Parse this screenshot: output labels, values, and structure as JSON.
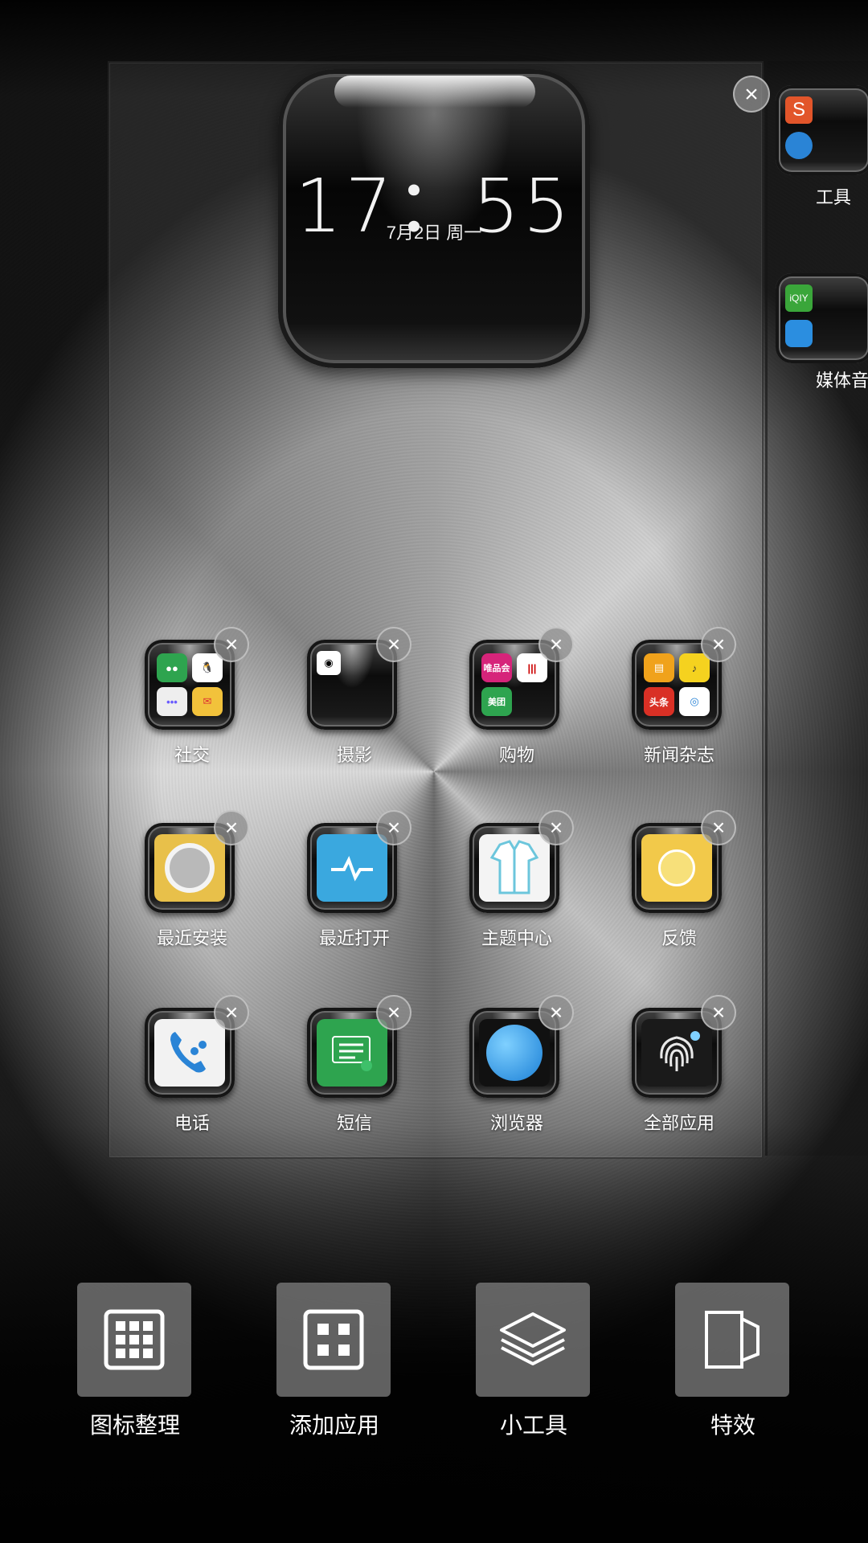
{
  "clock": {
    "time": "17：55",
    "date": "7月2日 周一"
  },
  "apps": [
    {
      "label": "社交"
    },
    {
      "label": "摄影"
    },
    {
      "label": "购物"
    },
    {
      "label": "新闻杂志"
    },
    {
      "label": "最近安装"
    },
    {
      "label": "最近打开"
    },
    {
      "label": "主题中心"
    },
    {
      "label": "反馈"
    },
    {
      "label": "电话"
    },
    {
      "label": "短信"
    },
    {
      "label": "浏览器"
    },
    {
      "label": "全部应用"
    }
  ],
  "folder_minis": {
    "shopping": [
      "唯品会",
      "美团"
    ],
    "news": [
      "头条"
    ]
  },
  "next_page": {
    "folder1": "工具",
    "folder2": "媒体音"
  },
  "toolbar": {
    "arrange": "图标整理",
    "add_app": "添加应用",
    "widgets": "小工具",
    "effects": "特效"
  },
  "colors": {
    "accent_blue": "#2a84d6",
    "green": "#2ea44f"
  }
}
